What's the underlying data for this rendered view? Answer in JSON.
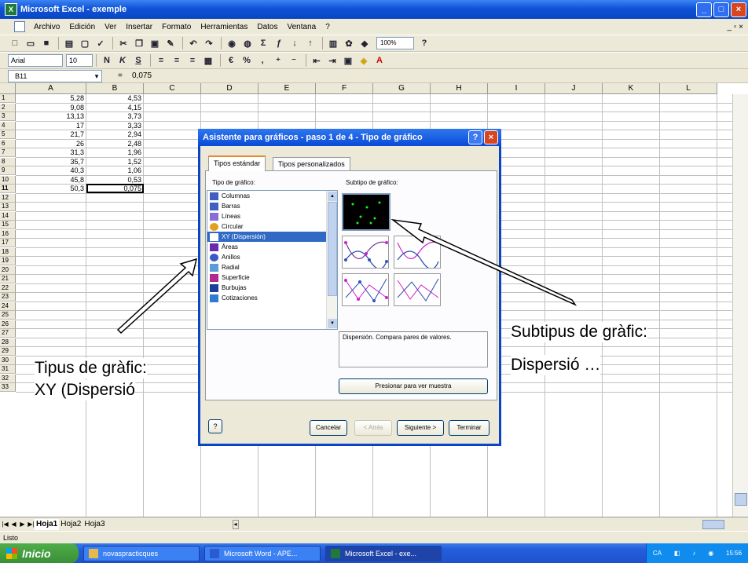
{
  "window": {
    "title": "Microsoft Excel - exemple"
  },
  "menu": {
    "items": [
      "Archivo",
      "Edición",
      "Ver",
      "Insertar",
      "Formato",
      "Herramientas",
      "Datos",
      "Ventana",
      "?"
    ]
  },
  "toolbar": {
    "font": "Arial",
    "size": "10",
    "zoom": "100%"
  },
  "formula": {
    "name_box": "B11",
    "fx": "=",
    "value": "0,075"
  },
  "columns": [
    "A",
    "B",
    "C",
    "D",
    "E",
    "F",
    "G",
    "H",
    "I",
    "J",
    "K",
    "L"
  ],
  "rows": [
    "1",
    "2",
    "3",
    "4",
    "5",
    "6",
    "7",
    "8",
    "9",
    "10",
    "11",
    "12",
    "13",
    "14",
    "15",
    "16",
    "17",
    "18",
    "19",
    "20",
    "21",
    "22",
    "23",
    "24",
    "25",
    "26",
    "27",
    "28",
    "29",
    "30",
    "31",
    "32",
    "33"
  ],
  "data": {
    "col_a": [
      "5,28",
      "9,08",
      "13,13",
      "17",
      "21,7",
      "26",
      "31,3",
      "35,7",
      "40,3",
      "45,8",
      "50,3"
    ],
    "col_b": [
      "4,53",
      "4,15",
      "3,73",
      "3,33",
      "2,94",
      "2,48",
      "1,96",
      "1,52",
      "1,06",
      "0,53",
      "0,075"
    ]
  },
  "sheet_tabs": [
    "Hoja1",
    "Hoja2",
    "Hoja3"
  ],
  "status": "Listo",
  "taskbar": {
    "start": "Inicio",
    "tasks": [
      "novaspracticques",
      "Microsoft Word - APE...",
      "Microsoft Excel - exe..."
    ],
    "clock": "15:56",
    "lang": "CA"
  },
  "dialog": {
    "title": "Asistente para gráficos - paso 1 de 4 - Tipo de gráfico",
    "tabs": [
      "Tipos estándar",
      "Tipos personalizados"
    ],
    "list_label": "Tipo de gráfico:",
    "subtype_label": "Subtipo de gráfico:",
    "chart_types": [
      "Columnas",
      "Barras",
      "Líneas",
      "Circular",
      "XY (Dispersión)",
      "Áreas",
      "Anillos",
      "Radial",
      "Superficie",
      "Burbujas",
      "Cotizaciones"
    ],
    "description": "Dispersión. Compara pares de valores.",
    "press_button": "Presionar para ver muestra",
    "buttons": {
      "cancel": "Cancelar",
      "back": "< Atrás",
      "next": "Siguiente >",
      "finish": "Terminar"
    }
  },
  "annotations": {
    "left_line1": "Tipus de gràfic:",
    "left_line2": "XY (Dispersió",
    "right_line1": "Subtipus de gràfic:",
    "right_line2": "Dispersió …"
  }
}
